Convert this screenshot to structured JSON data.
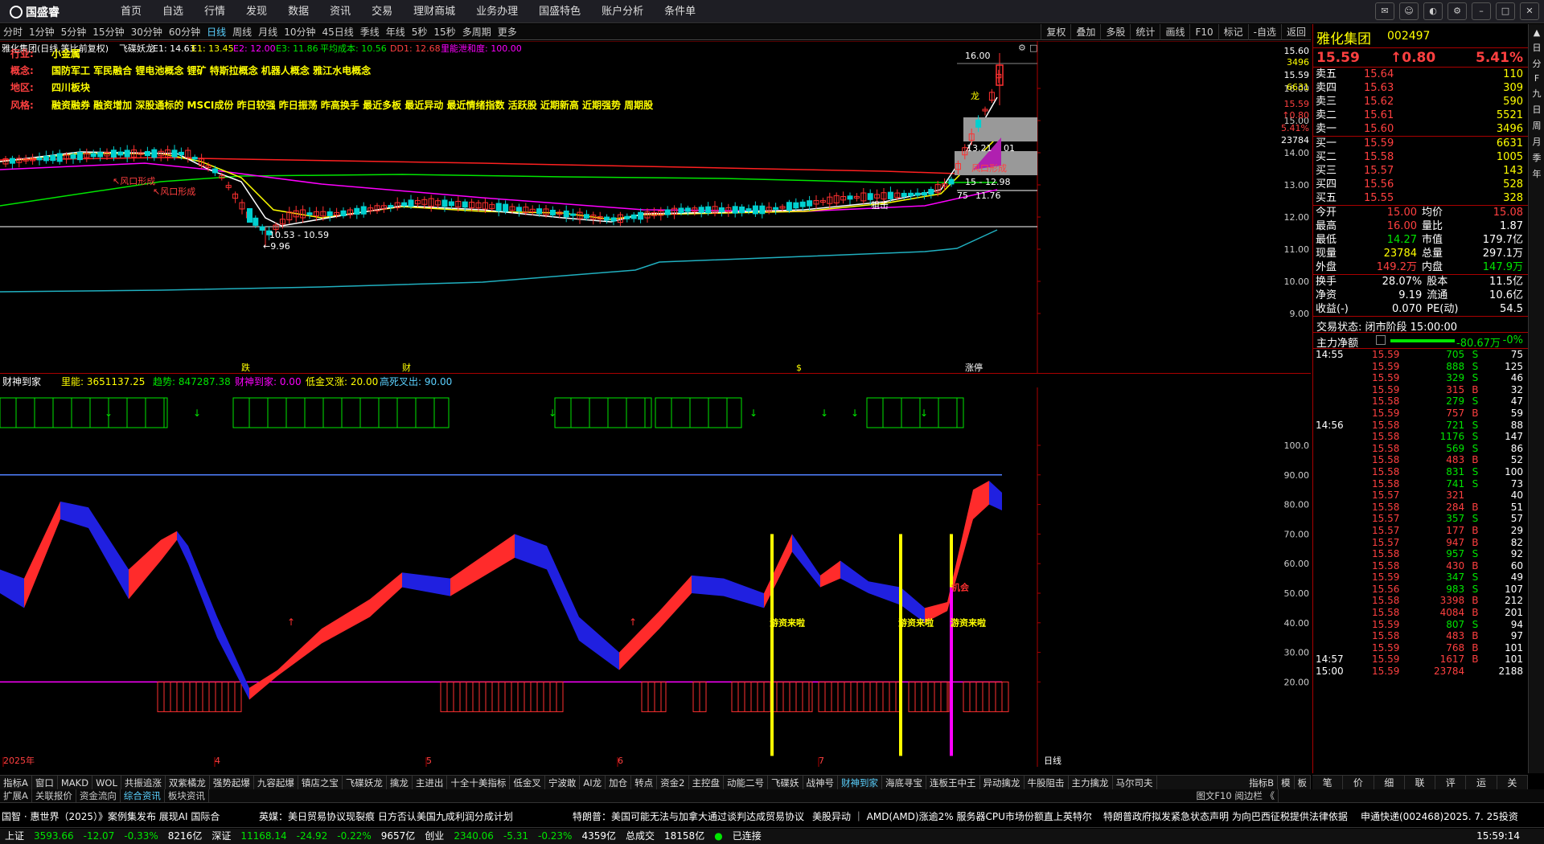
{
  "app": {
    "logo": "国盛睿",
    "nav": [
      "首页",
      "自选",
      "行情",
      "发现",
      "数据",
      "资讯",
      "交易",
      "理财商城",
      "业务办理",
      "国盛特色",
      "账户分析",
      "条件单"
    ]
  },
  "periods": [
    "分时",
    "1分钟",
    "5分钟",
    "15分钟",
    "30分钟",
    "60分钟",
    "日线",
    "周线",
    "月线",
    "10分钟",
    "45日线",
    "季线",
    "年线",
    "5秒",
    "15秒",
    "多周期",
    "更多"
  ],
  "active_period": "日线",
  "tools": [
    "复权",
    "叠加",
    "多股",
    "统计",
    "画线",
    "F10",
    "标记",
    "-自选",
    "返回"
  ],
  "chart_header": {
    "name": "雅化集团(日线,等比前复权)",
    "indicator": "飞碟妖龙",
    "e1": "E1: 14.63",
    "e1b": "E1: 13.45",
    "e2": "E2: 12.00",
    "e3": "E3: 11.86",
    "cost": "平均成本: 10.56",
    "dd1": "DD1: 12.68",
    "heat": "里能泄和度: 100.00"
  },
  "info": {
    "industry_label": "行业:",
    "industry": "小金属",
    "concept_label": "概念:",
    "concept": "国防军工 军民融合 锂电池概念 锂矿 特斯拉概念 机器人概念 雅江水电概念",
    "region_label": "地区:",
    "region": "四川板块",
    "style_label": "风格:",
    "style": "融资融券 融资增加 深股通标的 MSCI成份 昨日较强 昨日振荡 昨高换手 最近多板 最近异动 最近情绪指数 活跃股 近期新高 近期强势 周期股"
  },
  "main_annotations": {
    "wind1": "↖风口形成",
    "wind2": "↖风口形成",
    "wind3": "风口形成",
    "low_range": "10.53 - 10.59",
    "low": "←9.96",
    "high": "16.00",
    "range2": "15 - 12.98",
    "val1175": "11.76",
    "val1321": "13.21",
    "val01": "01",
    "val75": "75",
    "dragon": "龙",
    "shoot": "狙击",
    "bottom_labels": [
      "跌",
      "财",
      "$",
      "涨停"
    ]
  },
  "main_axis": [
    "16.00",
    "15.00",
    "14.00",
    "13.00",
    "12.00",
    "11.00",
    "10.00",
    "9.00"
  ],
  "price_tags": [
    {
      "text": "15.60",
      "color": "#ffffff"
    },
    {
      "text": "3496",
      "color": "#ffff00"
    },
    {
      "text": "15.59",
      "color": "#ffffff"
    },
    {
      "text": "6631",
      "color": "#ffff00"
    },
    {
      "text": "15.59",
      "color": "#ff4040"
    },
    {
      "text": "↑0.80",
      "color": "#ff4040"
    },
    {
      "text": "5.41%",
      "color": "#ff4040"
    },
    {
      "text": "23784",
      "color": "#ffffff"
    }
  ],
  "ind_header": {
    "name": "财神到家",
    "v1": "里能: 3651137.25",
    "v2": "趋势: 847287.38",
    "v3": "财神到家: 0.00",
    "v4": "低金叉涨: 20.00",
    "v5": "高死叉出: 90.00"
  },
  "ind_axis": [
    "100.0",
    "90.00",
    "80.00",
    "70.00",
    "60.00",
    "50.00",
    "40.00",
    "30.00",
    "20.00"
  ],
  "ind_labels": {
    "hot1": "游资来啦",
    "hot2": "游资来啦",
    "hot3": "游资来啦",
    "agg": "机会"
  },
  "x_dates": [
    "2025年",
    "4",
    "5",
    "6",
    "7"
  ],
  "x_axis_tag": "日线",
  "quote": {
    "name": "雅化集团",
    "code": "002497",
    "price": "15.59",
    "change": "↑0.80",
    "pct": "5.41%",
    "asks": [
      {
        "label": "卖五",
        "price": "15.64",
        "vol": "110"
      },
      {
        "label": "卖四",
        "price": "15.63",
        "vol": "309"
      },
      {
        "label": "卖三",
        "price": "15.62",
        "vol": "590"
      },
      {
        "label": "卖二",
        "price": "15.61",
        "vol": "5521"
      },
      {
        "label": "卖一",
        "price": "15.60",
        "vol": "3496"
      }
    ],
    "bids": [
      {
        "label": "买一",
        "price": "15.59",
        "vol": "6631"
      },
      {
        "label": "买二",
        "price": "15.58",
        "vol": "1005"
      },
      {
        "label": "买三",
        "price": "15.57",
        "vol": "143"
      },
      {
        "label": "买四",
        "price": "15.56",
        "vol": "528"
      },
      {
        "label": "买五",
        "price": "15.55",
        "vol": "328"
      }
    ],
    "stats": [
      [
        "今开",
        "15.00",
        "均价",
        "15.08"
      ],
      [
        "最高",
        "16.00",
        "量比",
        "1.87"
      ],
      [
        "最低",
        "14.27",
        "市值",
        "179.7亿"
      ],
      [
        "现量",
        "23784",
        "总量",
        "297.1万"
      ],
      [
        "外盘",
        "149.2万",
        "内盘",
        "147.9万"
      ]
    ],
    "stats2": [
      [
        "换手",
        "28.07%",
        "股本",
        "11.5亿"
      ],
      [
        "净资",
        "9.19",
        "流通",
        "10.6亿"
      ],
      [
        "收益(-)",
        "0.070",
        "PE(动)",
        "54.5"
      ]
    ],
    "trade_state": "交易状态: 闭市阶段 15:00:00",
    "net_label": "主力净额",
    "net_value": "-80.67万",
    "net_pct": "-0%"
  },
  "ticks": [
    {
      "t": "14:55",
      "p": "15.59",
      "v": "705",
      "bs": "S",
      "n": "75"
    },
    {
      "t": "",
      "p": "15.59",
      "v": "888",
      "bs": "S",
      "n": "125"
    },
    {
      "t": "",
      "p": "15.59",
      "v": "329",
      "bs": "S",
      "n": "46"
    },
    {
      "t": "",
      "p": "15.59",
      "v": "315",
      "bs": "B",
      "n": "32"
    },
    {
      "t": "",
      "p": "15.58",
      "v": "279",
      "bs": "S",
      "n": "47"
    },
    {
      "t": "",
      "p": "15.59",
      "v": "757",
      "bs": "B",
      "n": "59"
    },
    {
      "t": "14:56",
      "p": "15.58",
      "v": "721",
      "bs": "S",
      "n": "88"
    },
    {
      "t": "",
      "p": "15.58",
      "v": "1176",
      "bs": "S",
      "n": "147"
    },
    {
      "t": "",
      "p": "15.58",
      "v": "569",
      "bs": "S",
      "n": "86"
    },
    {
      "t": "",
      "p": "15.58",
      "v": "483",
      "bs": "B",
      "n": "52"
    },
    {
      "t": "",
      "p": "15.58",
      "v": "831",
      "bs": "S",
      "n": "100"
    },
    {
      "t": "",
      "p": "15.58",
      "v": "741",
      "bs": "S",
      "n": "73"
    },
    {
      "t": "",
      "p": "15.57",
      "v": "321",
      "bs": "",
      "n": "40"
    },
    {
      "t": "",
      "p": "15.58",
      "v": "284",
      "bs": "B",
      "n": "51"
    },
    {
      "t": "",
      "p": "15.57",
      "v": "357",
      "bs": "S",
      "n": "57"
    },
    {
      "t": "",
      "p": "15.57",
      "v": "177",
      "bs": "B",
      "n": "29"
    },
    {
      "t": "",
      "p": "15.57",
      "v": "947",
      "bs": "B",
      "n": "82"
    },
    {
      "t": "",
      "p": "15.58",
      "v": "957",
      "bs": "S",
      "n": "92"
    },
    {
      "t": "",
      "p": "15.58",
      "v": "430",
      "bs": "B",
      "n": "60"
    },
    {
      "t": "",
      "p": "15.59",
      "v": "347",
      "bs": "S",
      "n": "49"
    },
    {
      "t": "",
      "p": "15.56",
      "v": "983",
      "bs": "S",
      "n": "107"
    },
    {
      "t": "",
      "p": "15.58",
      "v": "3398",
      "bs": "B",
      "n": "212"
    },
    {
      "t": "",
      "p": "15.58",
      "v": "4084",
      "bs": "B",
      "n": "201"
    },
    {
      "t": "",
      "p": "15.59",
      "v": "807",
      "bs": "S",
      "n": "94"
    },
    {
      "t": "",
      "p": "15.58",
      "v": "483",
      "bs": "B",
      "n": "97"
    },
    {
      "t": "",
      "p": "15.59",
      "v": "768",
      "bs": "B",
      "n": "101"
    },
    {
      "t": "14:57",
      "p": "15.59",
      "v": "1617",
      "bs": "B",
      "n": "101"
    },
    {
      "t": "15:00",
      "p": "15.59",
      "v": "23784",
      "bs": "",
      "n": "2188"
    }
  ],
  "sidebar": [
    "日",
    "分",
    "F",
    "九",
    "日",
    "周",
    "月",
    "季",
    "年"
  ],
  "indicator_tabs": [
    "指标A",
    "窗口",
    "MAKD",
    "WOL",
    "共振追涨",
    "双紫橘龙",
    "强势起爆",
    "九容起爆",
    "镇店之宝",
    "飞碟妖龙",
    "擒龙",
    "主进出",
    "十全十美指标",
    "低金叉",
    "宁波敢",
    "AI龙",
    "加仓",
    "转点",
    "资金2",
    "主控盘",
    "动能二号",
    "飞碟妖",
    "战神号",
    "财神到家",
    "海底寻宝",
    "连板王中王",
    "异动擒龙",
    "牛股阻击",
    "主力擒龙",
    "马尔司夫"
  ],
  "active_tab": "财神到家",
  "tab_right": [
    "指标B",
    "模",
    "板"
  ],
  "right_tabs": [
    "笔",
    "价",
    "细",
    "联",
    "评",
    "运",
    "关"
  ],
  "subtabs": [
    "扩展A",
    "关联报价",
    "资金流向",
    "综合资讯",
    "板块资讯"
  ],
  "active_subtab": "综合资讯",
  "subtab_right": "图文F10 阅边栏 《",
  "news": [
    "国智 · 惠世界（2025）》案例集发布 展现AI 国际合",
    "英媒：美日贸易协议现裂痕 日方否认美国九成利润分成计划",
    "特朗普：美国可能无法与加拿大通过谈判达成贸易协议",
    "美股异动 ｜ AMD(AMD)涨逾2% 服务器CPU市场份额直上英特尔",
    "特朗普政府拟发紧急状态声明 为向巴西征税提供法律依据",
    "申通快递(002468)2025. 7. 25投资"
  ],
  "status": {
    "sh_label": "上证",
    "sh": "3593.66",
    "sh_chg": "-12.07",
    "sh_pct": "-0.33%",
    "sh_amt": "8216亿",
    "sz_label": "深证",
    "sz": "11168.14",
    "sz_chg": "-24.92",
    "sz_pct": "-0.22%",
    "sz_amt": "9657亿",
    "cy_label": "创业",
    "cy": "2340.06",
    "cy_chg": "-5.31",
    "cy_pct": "-0.23%",
    "cy_amt": "4359亿",
    "total_label": "总成交",
    "total": "18158亿",
    "conn": "已连接",
    "time": "15:59:14"
  }
}
